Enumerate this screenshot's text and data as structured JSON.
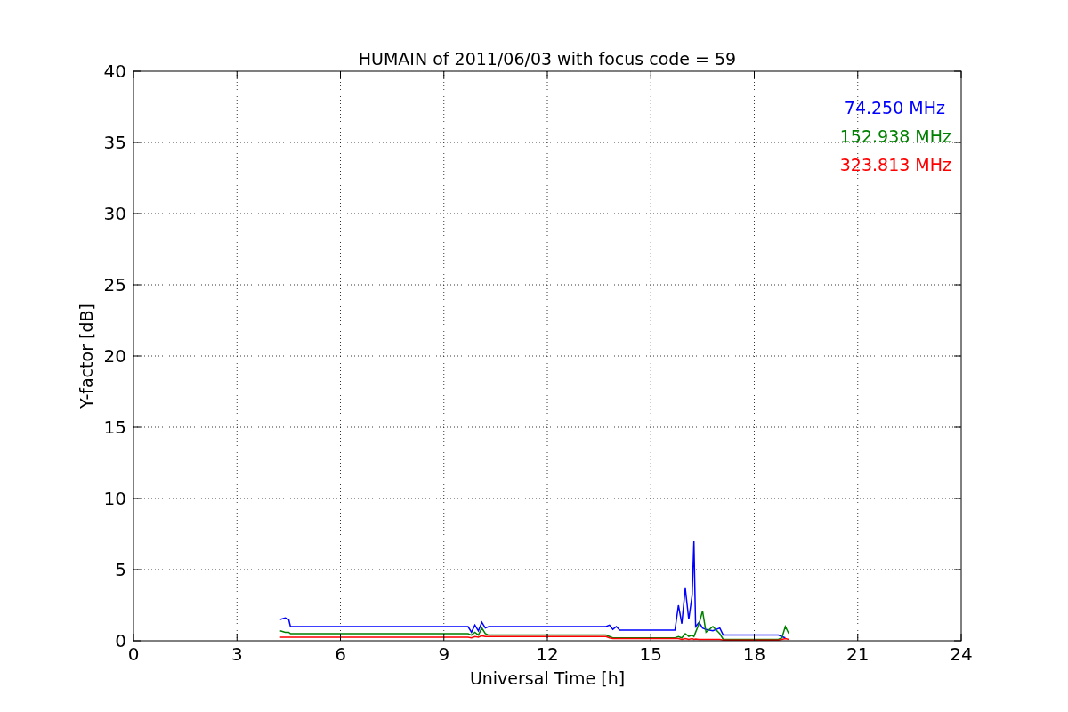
{
  "chart_data": {
    "type": "line",
    "title": "HUMAIN of 2011/06/03 with focus code = 59",
    "xlabel": "Universal Time [h]",
    "ylabel": "Y-factor [dB]",
    "x": [
      4.25,
      4.4,
      4.5,
      4.55,
      9.7,
      9.8,
      9.9,
      10.0,
      10.1,
      10.2,
      10.3,
      13.7,
      13.8,
      13.9,
      14.0,
      14.1,
      15.7,
      15.8,
      15.9,
      16.0,
      16.1,
      16.2,
      16.25,
      16.3,
      16.4,
      16.5,
      16.6,
      16.8,
      17.0,
      17.1,
      18.7,
      18.8,
      18.9,
      19.0
    ],
    "series": [
      {
        "name": "74.250 MHz",
        "color": "#0000ff",
        "values": [
          1.5,
          1.6,
          1.5,
          1.0,
          1.0,
          0.6,
          1.1,
          0.7,
          1.3,
          0.9,
          1.0,
          1.0,
          1.1,
          0.8,
          1.0,
          0.75,
          0.75,
          2.5,
          1.2,
          3.7,
          1.5,
          3.2,
          7.0,
          1.0,
          1.3,
          0.9,
          0.8,
          0.7,
          0.9,
          0.4,
          0.4,
          0.3,
          0.2,
          null
        ]
      },
      {
        "name": "152.938 MHz",
        "color": "#008000",
        "values": [
          0.7,
          0.6,
          0.6,
          0.5,
          0.5,
          0.4,
          0.6,
          0.4,
          0.9,
          0.5,
          0.4,
          0.4,
          0.3,
          0.2,
          0.2,
          0.2,
          0.2,
          0.3,
          0.2,
          0.5,
          0.3,
          0.4,
          0.3,
          0.6,
          1.2,
          2.1,
          0.6,
          1.0,
          0.5,
          0.1,
          0.1,
          0.2,
          1.0,
          0.5
        ]
      },
      {
        "name": "323.813 MHz",
        "color": "#ff0000",
        "values": [
          0.25,
          0.25,
          0.25,
          0.25,
          0.25,
          0.2,
          0.3,
          0.25,
          0.35,
          0.3,
          0.3,
          0.3,
          0.2,
          0.15,
          0.15,
          0.15,
          0.15,
          0.15,
          0.1,
          0.15,
          0.1,
          0.15,
          0.1,
          0.12,
          0.1,
          0.1,
          0.1,
          0.1,
          0.1,
          0.05,
          0.05,
          0.1,
          0.15,
          0.1
        ]
      }
    ],
    "grid": true,
    "xlim": [
      0,
      24
    ],
    "ylim": [
      0,
      40
    ],
    "xticks": [
      0,
      3,
      6,
      9,
      12,
      15,
      18,
      21,
      24
    ],
    "yticks": [
      0,
      5,
      10,
      15,
      20,
      25,
      30,
      35,
      40
    ]
  }
}
